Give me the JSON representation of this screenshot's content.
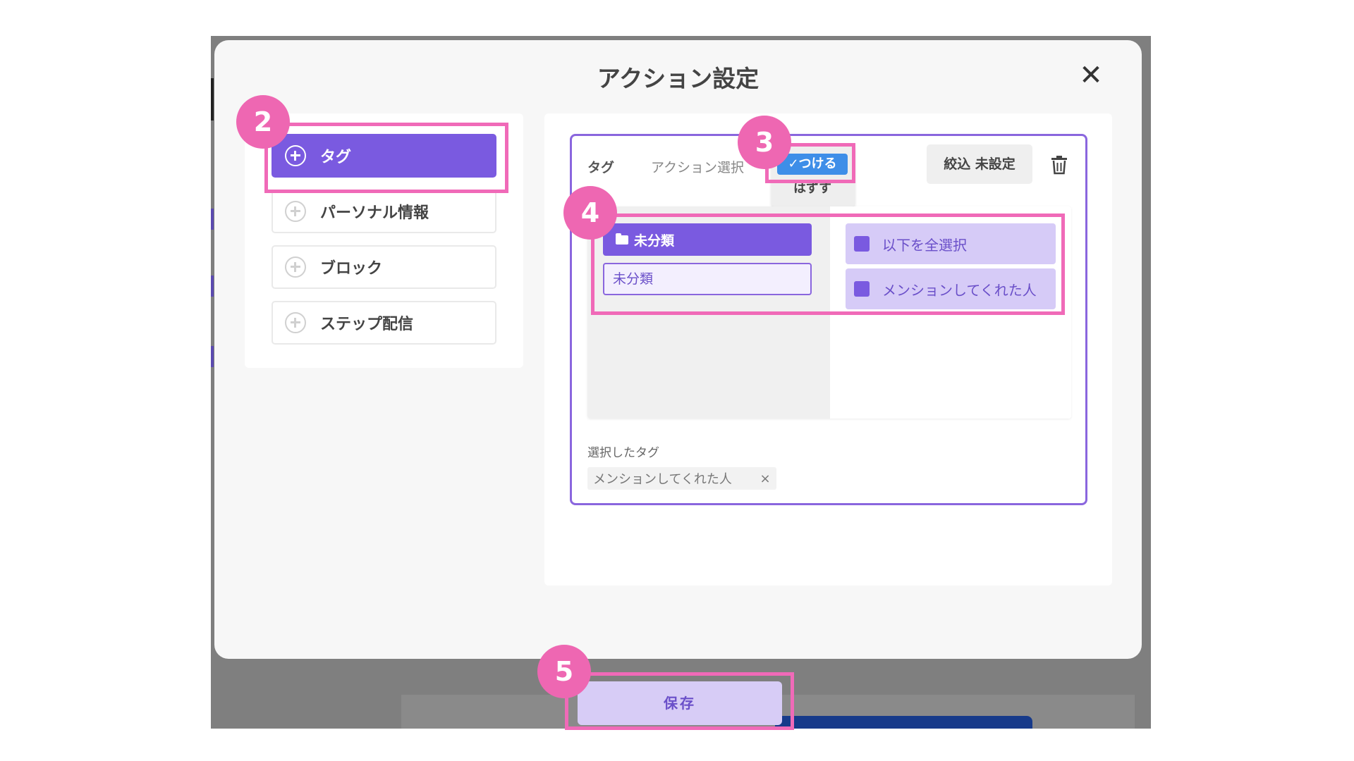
{
  "modal": {
    "title": "アクション設定",
    "close_label": "✕"
  },
  "categories": [
    {
      "label": "タグ",
      "active": true
    },
    {
      "label": "パーソナル情報",
      "active": false
    },
    {
      "label": "ブロック",
      "active": false
    },
    {
      "label": "ステップ配信",
      "active": false
    }
  ],
  "action": {
    "tag_label": "タグ",
    "select_label": "アクション選択",
    "options": {
      "attach": "✓つける",
      "remove": "はずす"
    },
    "filter_label": "絞込 未設定"
  },
  "tag_picker": {
    "folder_button": "未分類",
    "folder_item": "未分類",
    "tags": [
      "以下を全選択",
      "メンションしてくれた人"
    ]
  },
  "selected": {
    "label": "選択したタグ",
    "chips": [
      "メンションしてくれた人"
    ],
    "remove_label": "×"
  },
  "footer": {
    "save_label": "保存"
  },
  "annotations": [
    "2",
    "3",
    "4",
    "5"
  ],
  "colors": {
    "accent": "#7a5ae0",
    "annotation": "#ee67b2",
    "attach_option": "#3e8ee8"
  }
}
